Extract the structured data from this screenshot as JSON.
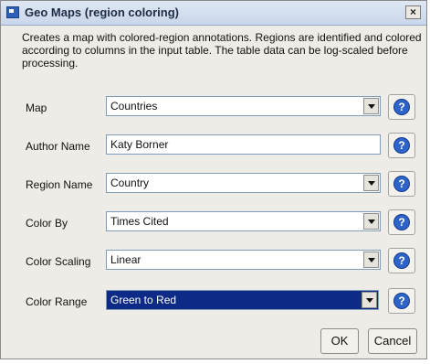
{
  "window": {
    "title": "Geo Maps (region coloring)",
    "close_label": "×"
  },
  "description": "Creates a map with colored-region annotations.  Regions are identified and colored according to columns in the input table.  The table data can be log-scaled before processing.",
  "fields": [
    {
      "label": "Map",
      "value": "Countries",
      "type": "dropdown"
    },
    {
      "label": "Author Name",
      "value": "Katy Borner",
      "type": "text"
    },
    {
      "label": "Region Name",
      "value": "Country",
      "type": "dropdown"
    },
    {
      "label": "Color By",
      "value": "Times Cited",
      "type": "dropdown"
    },
    {
      "label": "Color Scaling",
      "value": "Linear",
      "type": "dropdown"
    },
    {
      "label": "Color Range",
      "value": "Green to Red",
      "type": "dropdown",
      "selected": true
    }
  ],
  "help_glyph": "?",
  "buttons": {
    "ok": "OK",
    "cancel": "Cancel"
  },
  "colors": {
    "selection": "#0c2a86",
    "help_icon": "#2e63c9",
    "dialog_bg": "#eeece6"
  }
}
